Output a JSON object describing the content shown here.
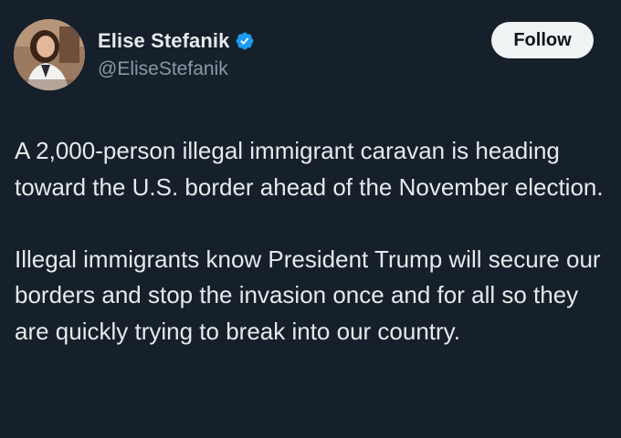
{
  "author": {
    "display_name": "Elise Stefanik",
    "handle": "@EliseStefanik",
    "verified_icon": "verified-badge-icon",
    "avatar_alt": "profile photo"
  },
  "actions": {
    "follow_label": "Follow"
  },
  "tweet": {
    "paragraph_1": "A 2,000-person illegal immigrant caravan is heading toward the U.S. border ahead of the November election.",
    "paragraph_2": "Illegal immigrants know President Trump will secure our borders and stop the invasion once and for all so they are quickly trying to break into our country."
  },
  "colors": {
    "background": "#15202b",
    "text": "#e7e9ea",
    "secondary_text": "#8b98a5",
    "verified_blue": "#1d9bf0",
    "button_bg": "#eff3f4"
  }
}
